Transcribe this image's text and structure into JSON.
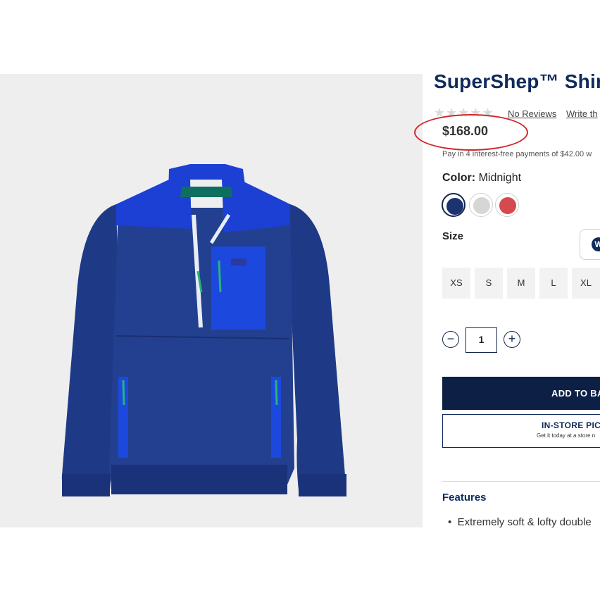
{
  "product": {
    "title": "SuperShep™ Shirt",
    "reviews_link": "No Reviews",
    "write_review": "Write th",
    "price": "$168.00",
    "installments": "Pay in 4 interest-free payments of $42.00 w"
  },
  "color": {
    "label": "Color:",
    "selected": "Midnight",
    "swatches": [
      {
        "name": "Midnight",
        "hex": "#1b3470"
      },
      {
        "name": "Gray",
        "hex": "#d6d6d6"
      },
      {
        "name": "Red",
        "hex": "#d44a4f"
      }
    ]
  },
  "size": {
    "label": "Size",
    "guide_icon": "W",
    "options": [
      "XS",
      "S",
      "M",
      "L",
      "XL"
    ]
  },
  "quantity": {
    "minus": "−",
    "value": "1",
    "plus": "+"
  },
  "actions": {
    "add_to_bag": "ADD TO BA",
    "pickup_title": "IN-STORE PIC",
    "pickup_sub": "Get it today at a store n"
  },
  "features": {
    "title": "Features",
    "items": [
      "Extremely soft & lofty double"
    ]
  },
  "colors": {
    "brand_navy": "#0f2a5c",
    "button_navy": "#0d1f45",
    "highlight_red": "#d4262c"
  }
}
